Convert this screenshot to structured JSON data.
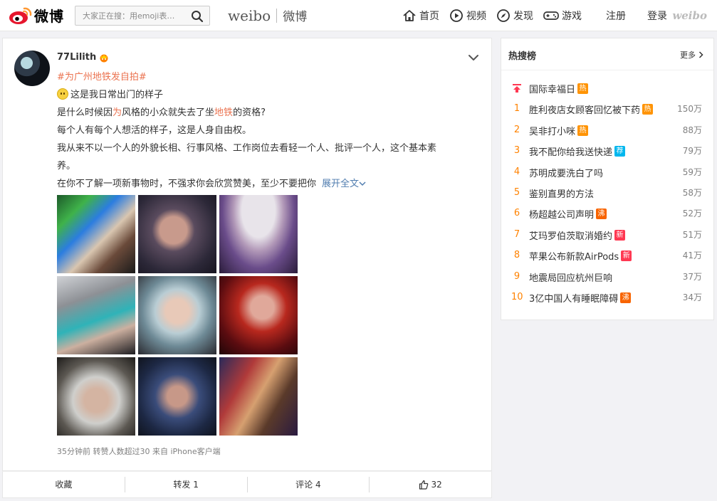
{
  "header": {
    "logo_text": "微博",
    "search_placeholder": "大家正在搜：用emoji表…",
    "brand_en": "weibo",
    "brand_cn": "微博",
    "nav": [
      {
        "label": "首页",
        "icon": "home-icon"
      },
      {
        "label": "视频",
        "icon": "video-icon"
      },
      {
        "label": "发现",
        "icon": "compass-icon"
      },
      {
        "label": "游戏",
        "icon": "gamepad-icon"
      }
    ],
    "register_label": "注册",
    "login_label": "登录",
    "small_logo": "weibo"
  },
  "post": {
    "username": "77Lilith",
    "topic": "#为广州地铁发自拍#",
    "line1": "这是我日常出门的样子",
    "line2_a": "是什么时候因",
    "line2_hl1": "为",
    "line2_b": "风格的小众就失去了坐",
    "line2_hl2": "地铁",
    "line2_c": "的资格?",
    "line3": "每个人有每个人想活的样子，这是人身自由权。",
    "line4a": "我从来不以一个人的外貌长相、行事风格、工作岗位去看轻一个人、批评一个人，这个基本素",
    "line4b": "养。",
    "line5": "在你不了解一项新事物时，不强求你会欣赏赞美，至少不要把你",
    "expand_label": "展开全文",
    "meta": "35分钟前 转赞人数超过30 来自 iPhone客户端"
  },
  "actions": {
    "collect": "收藏",
    "repost": "转发 1",
    "comment": "评论 4",
    "like": "32"
  },
  "hot": {
    "title": "热搜榜",
    "more": "更多",
    "pinned": {
      "word": "国际幸福日",
      "badge": "热",
      "badge_color": "#ff9406"
    },
    "items": [
      {
        "rank": "1",
        "word": "胜利夜店女顾客回忆被下药",
        "badge": "热",
        "badge_color": "#ff9406",
        "num": "150万"
      },
      {
        "rank": "2",
        "word": "吴非打小咪",
        "badge": "热",
        "badge_color": "#ff9406",
        "num": "88万"
      },
      {
        "rank": "3",
        "word": "我不配你给我送快递",
        "badge": "荐",
        "badge_color": "#00b7ee",
        "num": "79万"
      },
      {
        "rank": "4",
        "word": "苏明成要洗白了吗",
        "badge": "",
        "badge_color": "",
        "num": "59万"
      },
      {
        "rank": "5",
        "word": "鉴别直男的方法",
        "badge": "",
        "badge_color": "",
        "num": "58万"
      },
      {
        "rank": "6",
        "word": "杨超越公司声明",
        "badge": "沸",
        "badge_color": "#f86400",
        "num": "52万"
      },
      {
        "rank": "7",
        "word": "艾玛罗伯茨取消婚约",
        "badge": "新",
        "badge_color": "#ff3852",
        "num": "51万"
      },
      {
        "rank": "8",
        "word": "苹果公布新款AirPods",
        "badge": "新",
        "badge_color": "#ff3852",
        "num": "41万"
      },
      {
        "rank": "9",
        "word": "地震局回应杭州巨响",
        "badge": "",
        "badge_color": "",
        "num": "37万"
      },
      {
        "rank": "10",
        "word": "3亿中国人有睡眠障碍",
        "badge": "沸",
        "badge_color": "#f86400",
        "num": "34万"
      }
    ]
  }
}
